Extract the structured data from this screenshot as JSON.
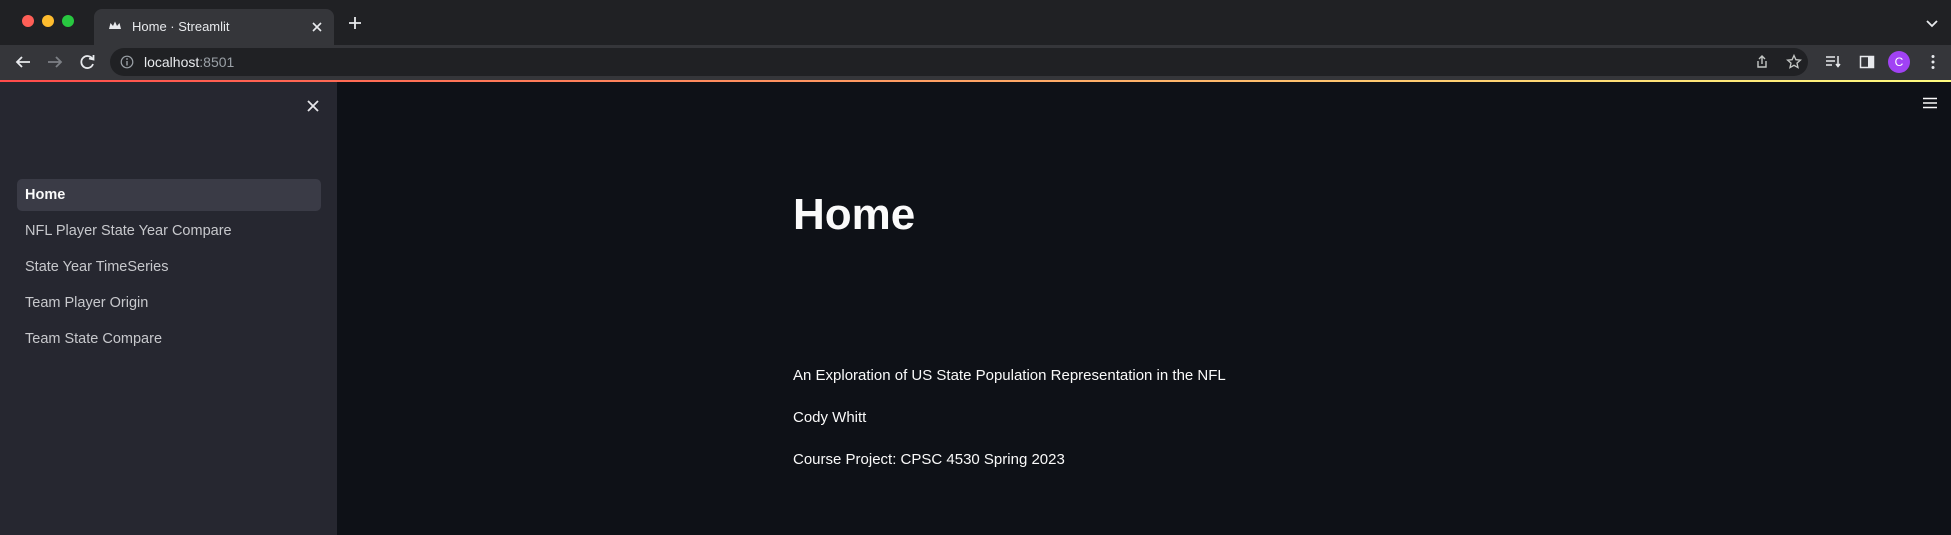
{
  "browser": {
    "tab": {
      "title": "Home · Streamlit",
      "favicon": "streamlit-crown-icon"
    },
    "address": {
      "host": "localhost",
      "port": ":8501"
    },
    "profile_initial": "C",
    "colors": {
      "titlebar": "#202124",
      "toolbar": "#35363a",
      "avatar": "#a142f4"
    }
  },
  "sidebar": {
    "items": [
      {
        "label": "Home",
        "active": true
      },
      {
        "label": "NFL Player State Year Compare",
        "active": false
      },
      {
        "label": "State Year TimeSeries",
        "active": false
      },
      {
        "label": "Team Player Origin",
        "active": false
      },
      {
        "label": "Team State Compare",
        "active": false
      }
    ]
  },
  "main": {
    "title": "Home",
    "paragraphs": [
      "An Exploration of US State Population Representation in the NFL",
      "Cody Whitt",
      "Course Project: CPSC 4530 Spring 2023"
    ]
  },
  "colors": {
    "background": "#0e1117",
    "sidebar": "#262730",
    "accent_start": "#ff4b4b",
    "accent_end": "#fffd80"
  }
}
